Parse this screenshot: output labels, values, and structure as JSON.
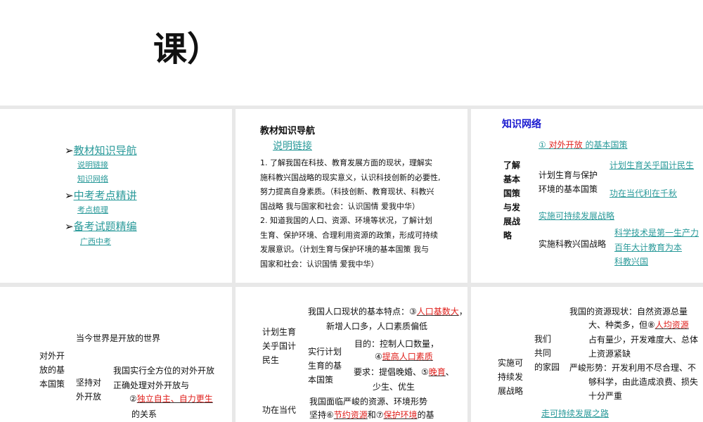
{
  "header": {
    "title": "课）"
  },
  "slide1": {
    "items": [
      {
        "label": "教材知识导航",
        "sub": [
          "说明链接",
          "知识网络"
        ]
      },
      {
        "label": "中考考点精讲",
        "sub": [
          "考点梳理"
        ]
      },
      {
        "label": "备考试题精编",
        "sub": [
          "广西中考"
        ]
      }
    ]
  },
  "slide2": {
    "heading": "教材知识导航",
    "link": "说明链接",
    "lines": [
      "1.  了解我国在科技、教育发展方面的现状，理解实",
      "施科教兴国战略的现实意义，认识科技创新的必要性,",
      "努力提高自身素质。（科技创新、教育现状、科教兴",
      "国战略 我与国家和社会：认识国情 爱我中华）",
      "2.  知道我国的人口、资源、环境等状况，了解计划",
      "生育、保护环境、合理利用资源的政策，形成可持续",
      "发展意识。（计划生育与保护环境的基本国策 我与",
      "国家和社会：认识国情 爱我中华）"
    ]
  },
  "slide3": {
    "heading": "知识网络",
    "n1": "①",
    "n1_answer": "对外开放",
    "n1_suffix": "的基本国策",
    "left": [
      "了解",
      "基本",
      "国策",
      "与发",
      "展战",
      "略"
    ],
    "mid1": [
      "计划生育与保护",
      "环境的基本国策"
    ],
    "link1": "计划生育关乎国计民生",
    "link2": "功在当代利在千秋",
    "link3": "实施可持续发展战略",
    "mid2": "实施科教兴国战略",
    "link4": "科学技术是第一生产力",
    "link5": "百年大计教育为本",
    "link6": "科教兴国"
  },
  "slide4": {
    "left": [
      "对外开",
      "放的基",
      "本国策"
    ],
    "top": "当今世界是开放的世界",
    "mid": [
      "坚持对",
      "外开放"
    ],
    "r1": "我国实行全方位的对外开放",
    "r2": "正确处理对外开放与",
    "n2": "②",
    "a2": "独立自主、自力更生",
    "r3": "的关系"
  },
  "slide5": {
    "left": [
      "计划生育",
      "关乎国计",
      "民生"
    ],
    "l1": "我国人口现状的基本特点：③",
    "a3": "人口基数大",
    "l1end": "，",
    "l2": "新增人口多，人口素质偏低",
    "mid": [
      "实行计划",
      "生育的基",
      "本国策"
    ],
    "g1": "目的：控制人口数量，",
    "n4": "④",
    "a4": "提高人口素质",
    "g2": "要求：提倡晚婚、⑤",
    "a5": "晚育",
    "g2end": "、",
    "g3": "少生、优生",
    "left2": "功在当代",
    "b1": "我国面临严峻的资源、环境形势",
    "b2": "坚持⑥",
    "a6": "节约资源",
    "b3": "和⑦",
    "a7": "保护环境",
    "b4": "的基"
  },
  "slide6": {
    "left": [
      "实施可",
      "持续发",
      "展战略"
    ],
    "mid": [
      "我们",
      "共同",
      "的家园"
    ],
    "r1": "我国的资源现状：自然资源总量",
    "r2": "大、种类多，但⑧",
    "a8": "人均资源",
    "r3": "占有量少，开发难度大、总体",
    "r4": "上资源紧缺",
    "r5": "严峻形势：开发利用不尽合理、不",
    "r6": "够科学，由此造成浪费、损失",
    "r7": "十分严重",
    "bottom": "走可持续发展之路"
  }
}
